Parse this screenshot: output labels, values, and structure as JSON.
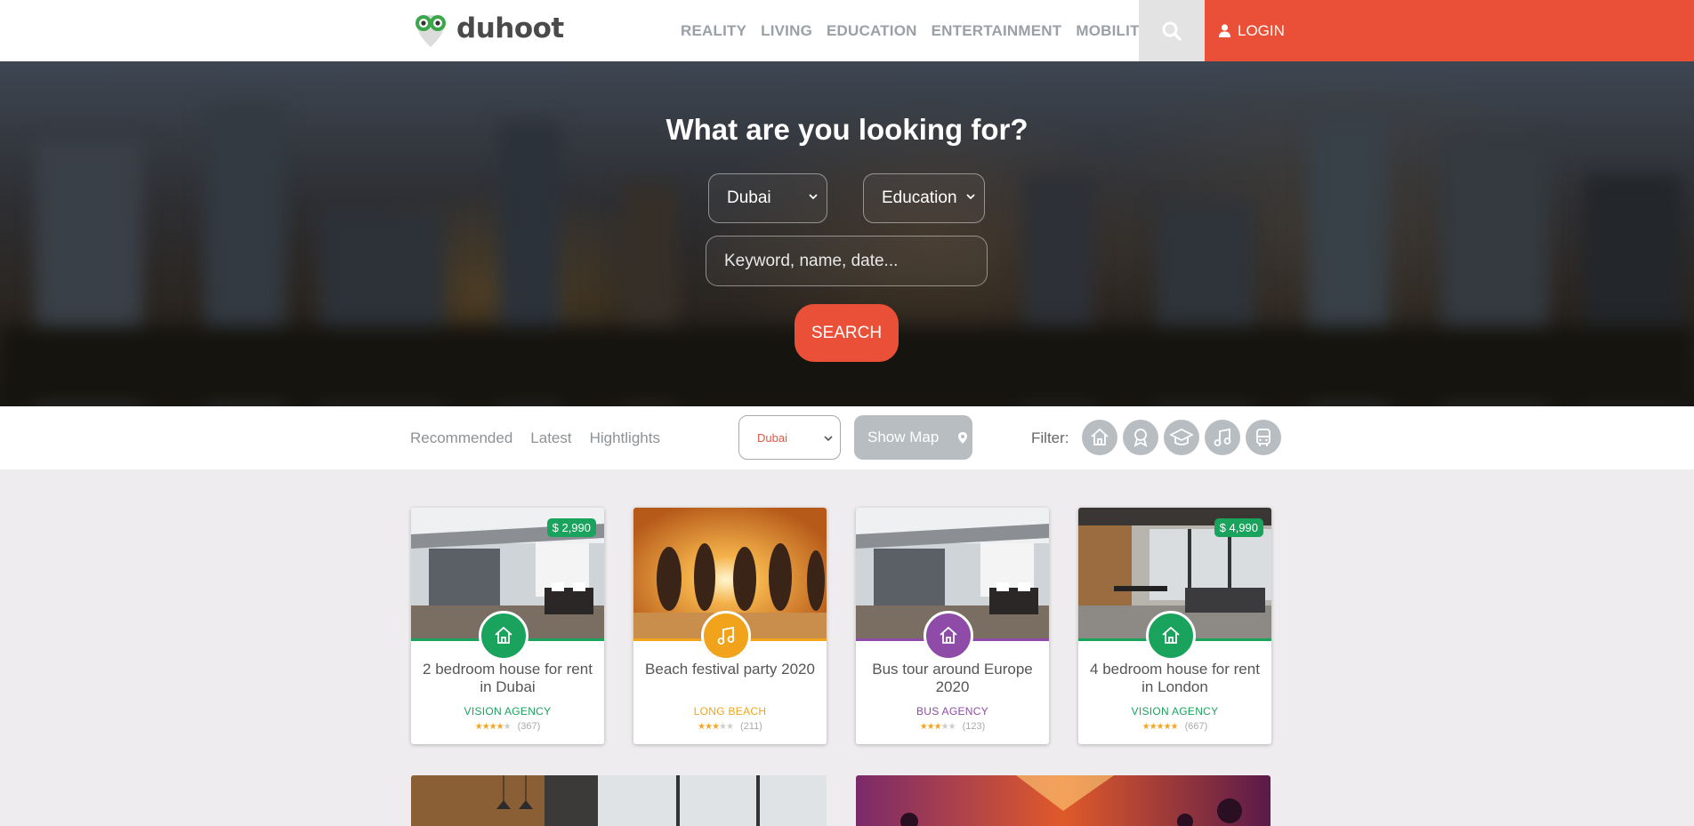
{
  "header": {
    "brand": "duhoot",
    "nav": [
      "REALITY",
      "LIVING",
      "EDUCATION",
      "ENTERTAINMENT",
      "MOBILITY"
    ],
    "login_label": "LOGIN",
    "accent_color": "#ea5038"
  },
  "hero": {
    "title": "What are you looking for?",
    "city_select": "Dubai",
    "category_select": "Education",
    "search_placeholder": "Keyword, name, date...",
    "search_label": "SEARCH"
  },
  "filterbar": {
    "tabs": [
      "Recommended",
      "Latest",
      "Hightlights"
    ],
    "city_select": "Dubai",
    "show_map_label": "Show Map",
    "filter_label": "Filter:",
    "filter_icons": [
      "home-icon",
      "award-icon",
      "graduation-cap-icon",
      "music-icon",
      "bus-icon"
    ]
  },
  "cards": [
    {
      "title": "2 bedroom house for rent in Dubai",
      "agency": "VISION AGENCY",
      "reviews": "(367)",
      "price": "$ 2,990",
      "rating": 4,
      "category_icon": "home-icon",
      "color": "#1aa35c"
    },
    {
      "title": "Beach festival party 2020",
      "agency": "LONG BEACH",
      "reviews": "(211)",
      "price": "",
      "rating": 3,
      "category_icon": "music-icon",
      "color": "#f0a31b"
    },
    {
      "title": "Bus tour around Europe 2020",
      "agency": "BUS AGENCY",
      "reviews": "(123)",
      "price": "",
      "rating": 3,
      "category_icon": "home-icon",
      "color": "#8e4ba8"
    },
    {
      "title": "4 bedroom house for rent in London",
      "agency": "VISION AGENCY",
      "reviews": "(667)",
      "price": "$ 4,990",
      "rating": 5,
      "category_icon": "home-icon",
      "color": "#1aa35c"
    }
  ]
}
